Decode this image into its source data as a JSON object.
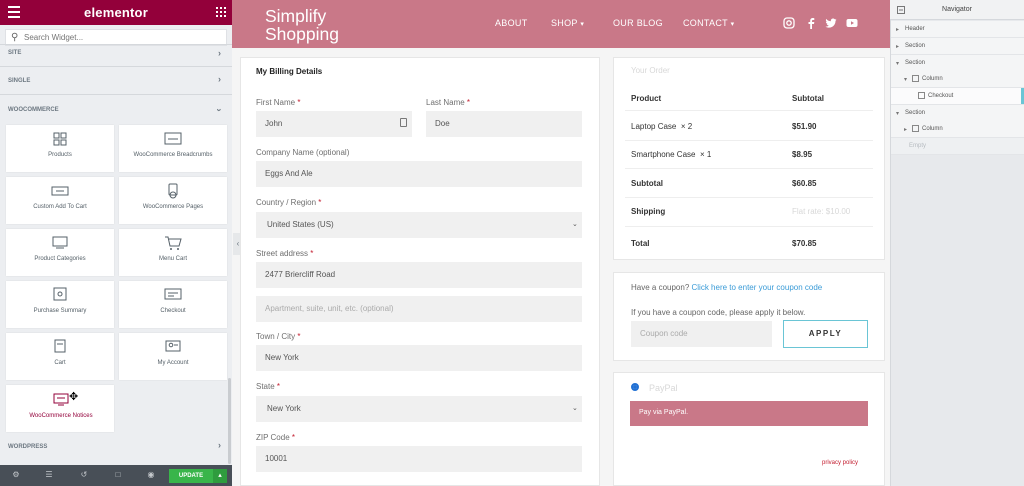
{
  "editor": {
    "logo": "elementor",
    "search_placeholder": "Search Widget...",
    "categories": {
      "site": "SITE",
      "single": "SINGLE",
      "woocommerce": "WOOCOMMERCE",
      "wordpress": "WORDPRESS"
    },
    "widgets": [
      {
        "label": "Products",
        "icon": "products-icon"
      },
      {
        "label": "WooCommerce Breadcrumbs",
        "icon": "breadcrumbs-icon"
      },
      {
        "label": "Custom Add To Cart",
        "icon": "add-to-cart-icon"
      },
      {
        "label": "WooCommerce Pages",
        "icon": "pages-icon"
      },
      {
        "label": "Product Categories",
        "icon": "categories-icon"
      },
      {
        "label": "Menu Cart",
        "icon": "cart-icon"
      },
      {
        "label": "Purchase Summary",
        "icon": "purchase-summary-icon"
      },
      {
        "label": "Checkout",
        "icon": "checkout-icon"
      },
      {
        "label": "Cart",
        "icon": "cart-page-icon"
      },
      {
        "label": "My Account",
        "icon": "account-icon"
      },
      {
        "label": "WooCommerce Notices",
        "icon": "notices-icon"
      }
    ],
    "update_label": "UPDATE",
    "colors": {
      "brand": "#93003a",
      "update": "#39b54a"
    }
  },
  "site": {
    "logo_line1": "Simplify",
    "logo_line2": "Shopping",
    "nav": {
      "about": "ABOUT",
      "shop": "SHOP",
      "blog": "OUR BLOG",
      "contact": "CONTACT"
    },
    "header_color": "#c97888"
  },
  "billing": {
    "title": "My Billing Details",
    "first_name_label": "First Name",
    "first_name": "John",
    "last_name_label": "Last Name",
    "last_name": "Doe",
    "company_label": "Company Name (optional)",
    "company": "Eggs And Ale",
    "country_label": "Country / Region",
    "country": "United States (US)",
    "street_label": "Street address",
    "street": "2477 Briercliff Road",
    "apartment_placeholder": "Apartment, suite, unit, etc. (optional)",
    "city_label": "Town / City",
    "city": "New York",
    "state_label": "State",
    "state": "New York",
    "zip_label": "ZIP Code",
    "zip": "10001",
    "required_mark": "*"
  },
  "order": {
    "title": "Your Order",
    "product_header": "Product",
    "subtotal_header": "Subtotal",
    "items": [
      {
        "name": "Laptop Case",
        "qty": "× 2",
        "price": "$51.90"
      },
      {
        "name": "Smartphone Case",
        "qty": "× 1",
        "price": "$8.95"
      }
    ],
    "subtotal_label": "Subtotal",
    "subtotal": "$60.85",
    "shipping_label": "Shipping",
    "shipping_value": "Flat rate: $10.00",
    "total_label": "Total",
    "total": "$70.85"
  },
  "coupon": {
    "question": "Have a coupon?",
    "link": "Click here to enter your coupon code",
    "hint": "If you have a coupon code, please apply it below.",
    "placeholder": "Coupon code",
    "apply": "APPLY"
  },
  "payment": {
    "method": "PayPal",
    "note": "Pay via PayPal.",
    "privacy": "privacy policy"
  },
  "navigator": {
    "title": "Navigator",
    "rows": [
      {
        "label": "Header",
        "indent": 0
      },
      {
        "label": "Section",
        "indent": 0
      },
      {
        "label": "Section",
        "indent": 0
      },
      {
        "label": "Column",
        "indent": 1
      },
      {
        "label": "Checkout",
        "indent": 2
      },
      {
        "label": "Section",
        "indent": 0
      },
      {
        "label": "Column",
        "indent": 1
      }
    ],
    "empty_hint": "Empty"
  }
}
